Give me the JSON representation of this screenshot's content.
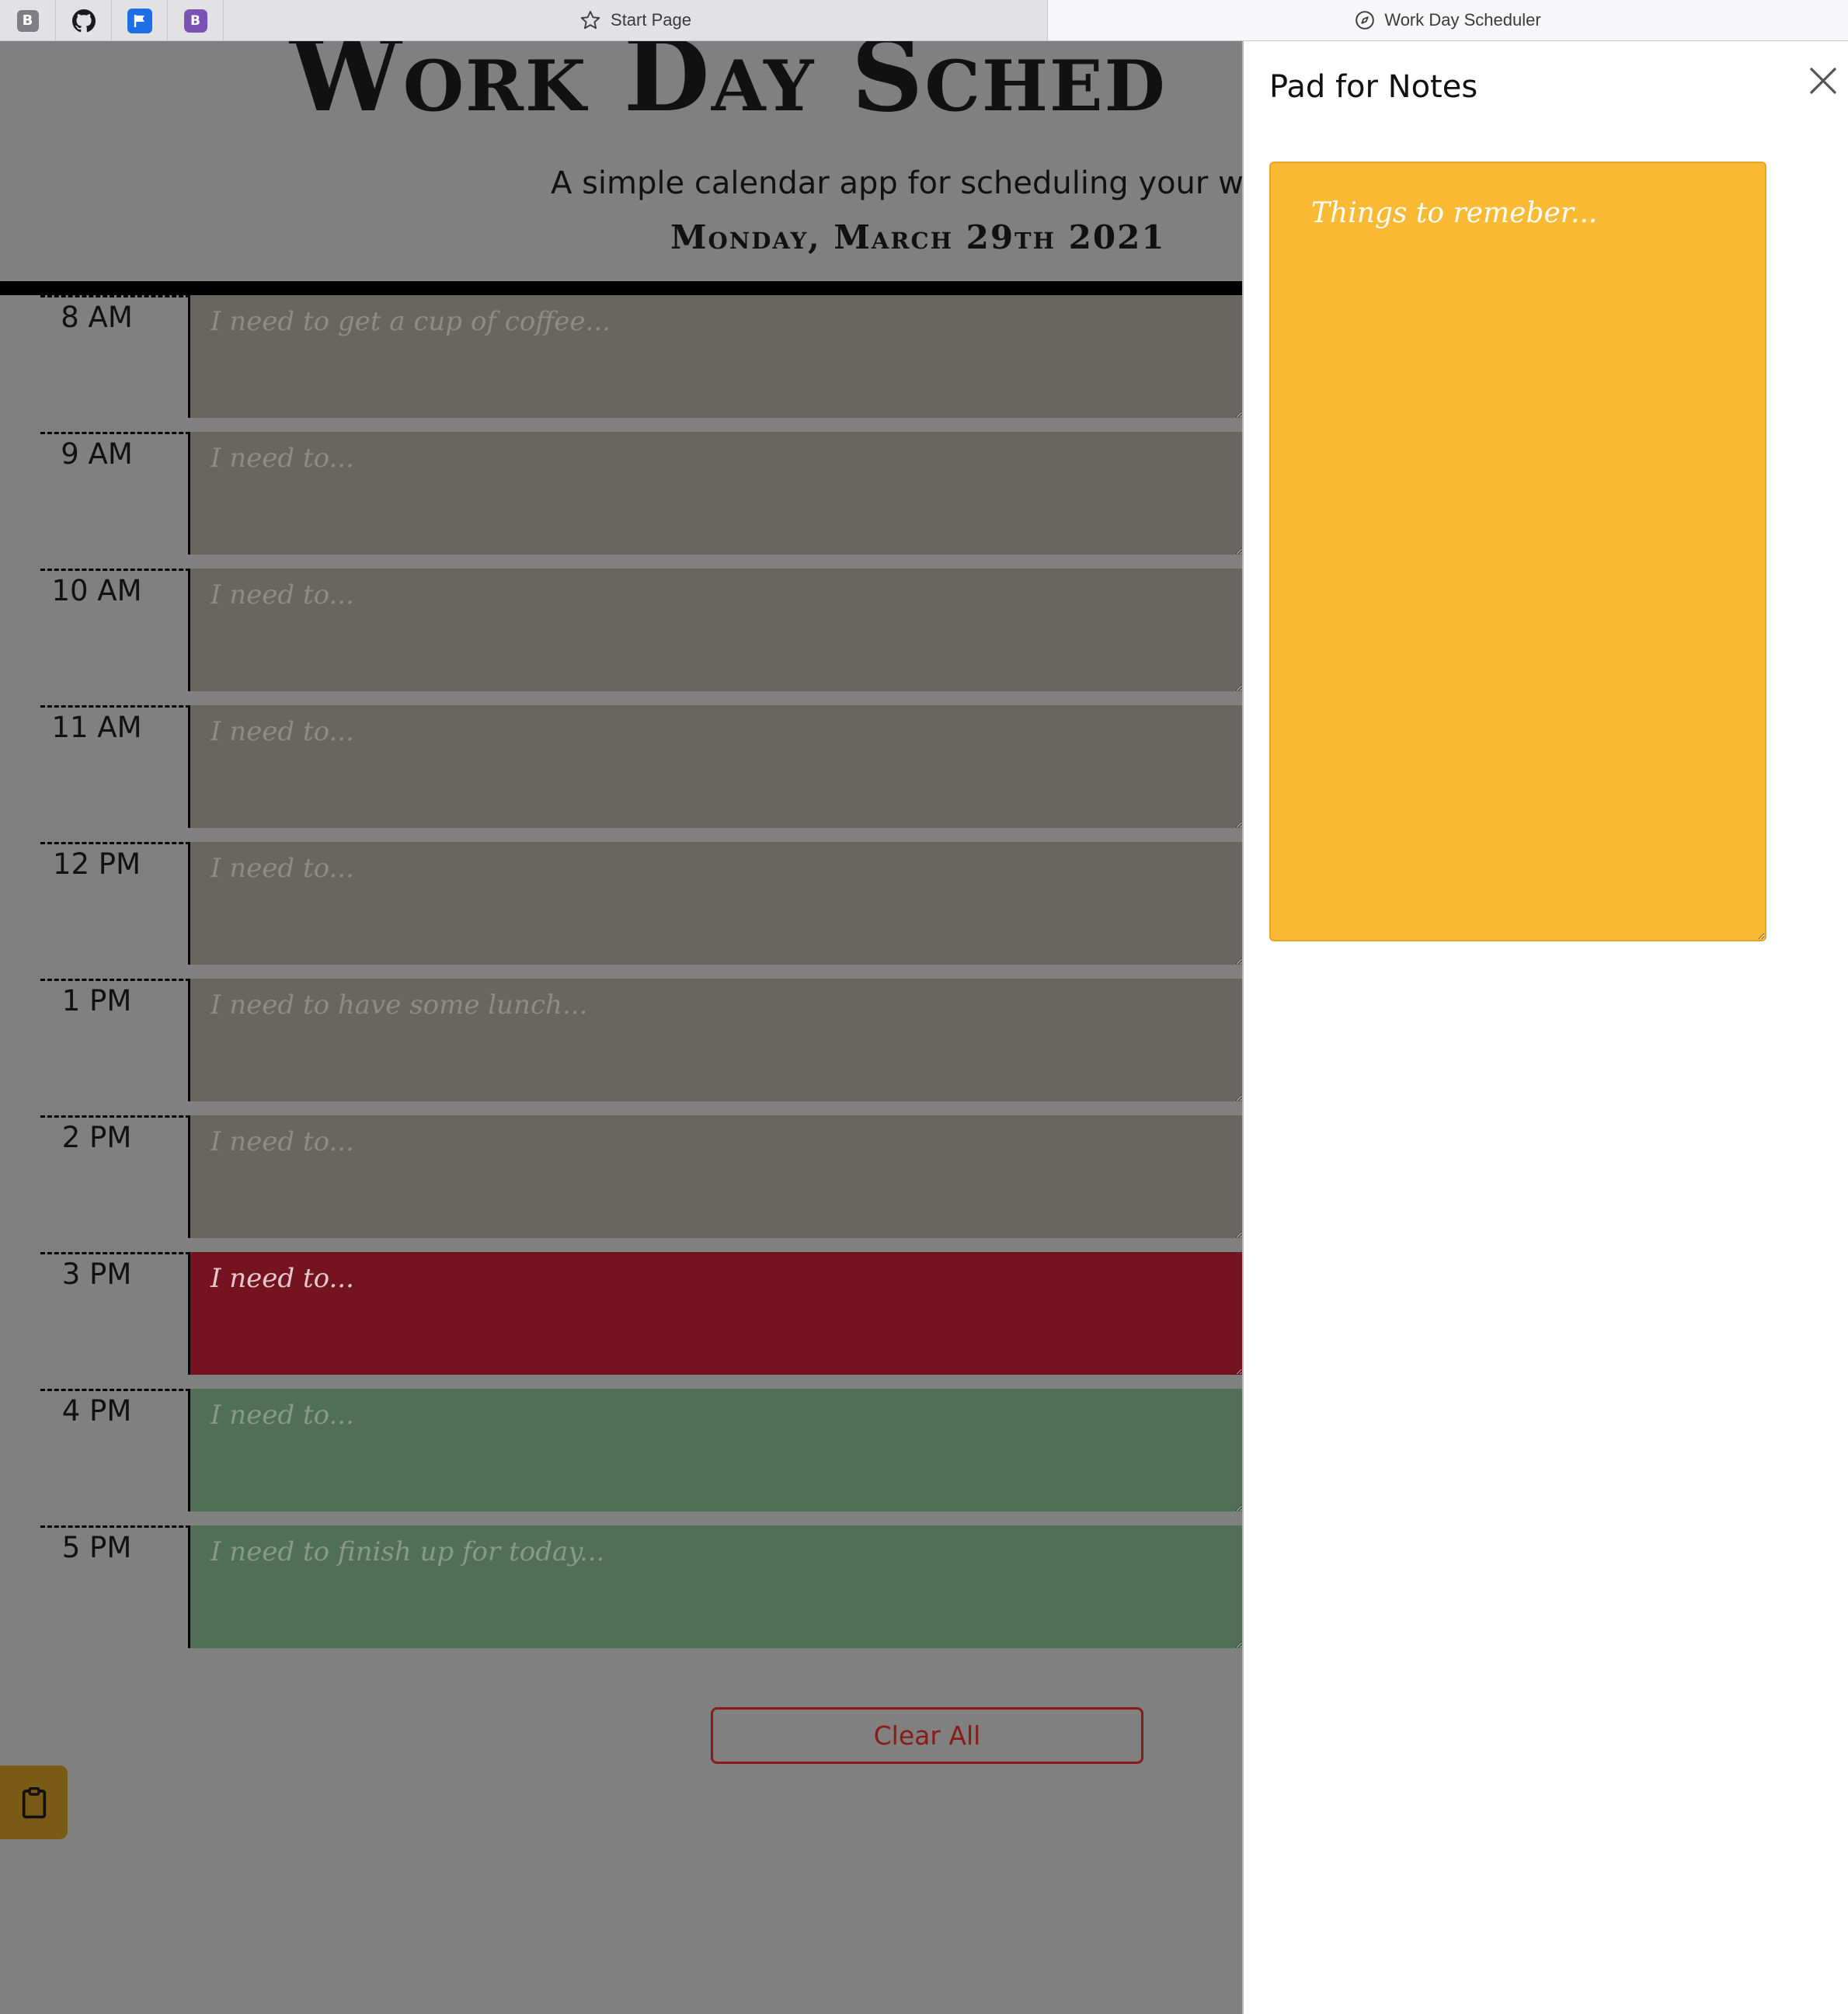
{
  "browser": {
    "pinned_tabs": [
      {
        "icon": "b-badge-icon",
        "glyph": "B"
      },
      {
        "icon": "github-icon"
      },
      {
        "icon": "flag-icon"
      },
      {
        "icon": "bootstrap-icon",
        "glyph": "B"
      }
    ],
    "tabs": [
      {
        "label": "Start Page",
        "icon": "star-icon"
      },
      {
        "label": "Work Day Scheduler",
        "icon": "compass-icon",
        "active": true
      }
    ]
  },
  "header": {
    "title": "Work Day Sched",
    "lead": "A simple calendar app for scheduling your work",
    "current_day": "Monday, March 29th 2021"
  },
  "schedule": {
    "rows": [
      {
        "hour": "8 AM",
        "placeholder": "I need to get a cup of coffee...",
        "state": "past"
      },
      {
        "hour": "9 AM",
        "placeholder": "I need to...",
        "state": "past"
      },
      {
        "hour": "10 AM",
        "placeholder": "I need to...",
        "state": "past"
      },
      {
        "hour": "11 AM",
        "placeholder": "I need to...",
        "state": "past"
      },
      {
        "hour": "12 PM",
        "placeholder": "I need to...",
        "state": "past"
      },
      {
        "hour": "1 PM",
        "placeholder": "I need to have some lunch...",
        "state": "past"
      },
      {
        "hour": "2 PM",
        "placeholder": "I need to...",
        "state": "past"
      },
      {
        "hour": "3 PM",
        "placeholder": "I need to...",
        "state": "present"
      },
      {
        "hour": "4 PM",
        "placeholder": "I need to...",
        "state": "future"
      },
      {
        "hour": "5 PM",
        "placeholder": "I need to finish up for today...",
        "state": "future"
      }
    ],
    "clear_label": "Clear All"
  },
  "notes_toggle": {
    "icon": "clipboard-icon"
  },
  "offcanvas": {
    "title": "Pad for Notes",
    "close_icon": "close-icon",
    "notes_placeholder": "Things to remeber..."
  },
  "colors": {
    "past": "#696661",
    "present": "#751420",
    "future": "#506f56",
    "notes_pad": "#fbba34",
    "clear_button": "#8b1a1a",
    "overlay": "#808080"
  }
}
